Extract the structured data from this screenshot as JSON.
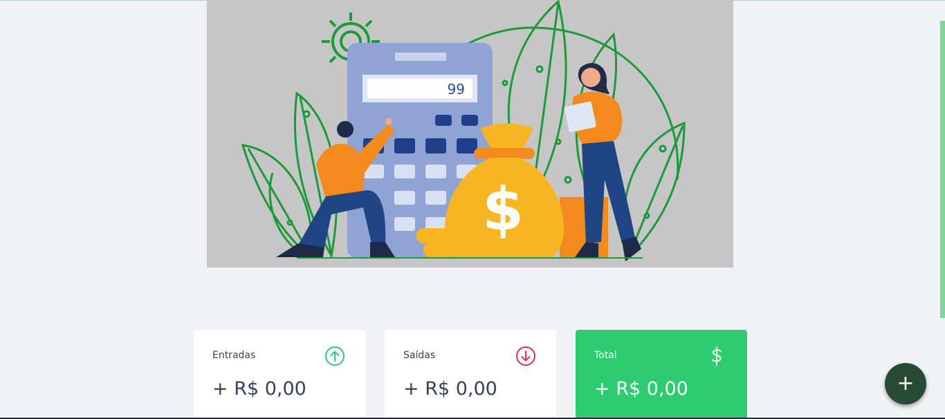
{
  "hero": {
    "calculator_display": "99",
    "colors": {
      "background": "#c6c6c6",
      "calculator": "#8fa3d4",
      "bag": "#f7b522",
      "shirt": "#f28a1e",
      "pants": "#1f4585",
      "leaf_stroke": "#1a9a3a"
    }
  },
  "cards": {
    "income": {
      "label": "Entradas",
      "value": "+ R$ 0,00",
      "icon": "arrow-up-circle-icon",
      "icon_color": "#2ecc71"
    },
    "expense": {
      "label": "Saídas",
      "value": "+ R$ 0,00",
      "icon": "arrow-down-circle-icon",
      "icon_color": "#e92c4c"
    },
    "total": {
      "label": "Total",
      "value": "+ R$ 0,00",
      "icon": "dollar-sign-icon",
      "background": "#2ecc71"
    }
  },
  "fab": {
    "label": "+"
  }
}
